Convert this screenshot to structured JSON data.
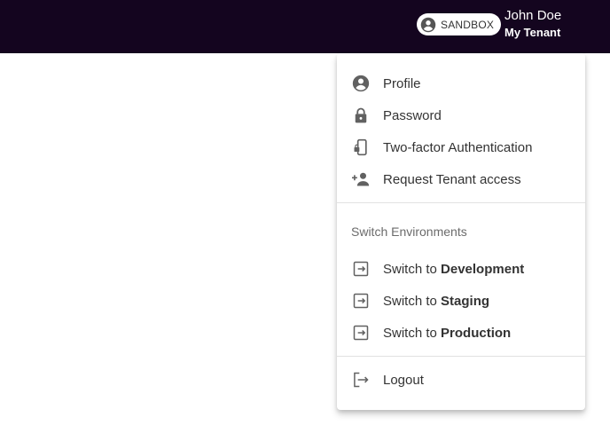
{
  "header": {
    "environment_badge": "SANDBOX",
    "user_name": "John Doe",
    "tenant_name": "My Tenant",
    "background_color": "#14051f"
  },
  "menu": {
    "account_items": [
      {
        "label": "Profile",
        "icon": "account-circle-icon"
      },
      {
        "label": "Password",
        "icon": "lock-icon"
      },
      {
        "label": "Two-factor Authentication",
        "icon": "phone-lock-icon"
      },
      {
        "label": "Request Tenant access",
        "icon": "person-add-icon"
      }
    ],
    "environments_header": "Switch Environments",
    "environment_items": [
      {
        "prefix": "Switch to",
        "target": "Development",
        "icon": "switch-env-icon"
      },
      {
        "prefix": "Switch to",
        "target": "Staging",
        "icon": "switch-env-icon"
      },
      {
        "prefix": "Switch to",
        "target": "Production",
        "icon": "switch-env-icon"
      }
    ],
    "logout_label": "Logout",
    "logout_icon": "logout-icon",
    "icon_color": "#616161",
    "text_color": "#333333"
  }
}
